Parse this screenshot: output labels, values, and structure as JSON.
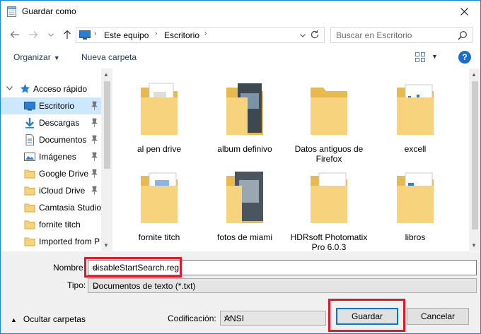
{
  "window": {
    "title": "Guardar como"
  },
  "address": {
    "crumbs": [
      "Este equipo",
      "Escritorio"
    ]
  },
  "search": {
    "placeholder": "Buscar en Escritorio"
  },
  "toolbar": {
    "organize_label": "Organizar",
    "new_folder_label": "Nueva carpeta"
  },
  "nav": {
    "quick_access": "Acceso rápido",
    "items": [
      {
        "label": "Escritorio",
        "icon": "desktop-icon",
        "pinned": true,
        "selected": true
      },
      {
        "label": "Descargas",
        "icon": "download-icon",
        "pinned": true
      },
      {
        "label": "Documentos",
        "icon": "documents-icon",
        "pinned": true
      },
      {
        "label": "Imágenes",
        "icon": "pictures-icon",
        "pinned": true
      },
      {
        "label": "Google Drive",
        "icon": "folder-icon",
        "pinned": true
      },
      {
        "label": "iCloud Drive",
        "icon": "folder-icon",
        "pinned": true
      },
      {
        "label": "Camtasia Studio",
        "icon": "folder-icon",
        "pinned": false
      },
      {
        "label": "fornite titch",
        "icon": "folder-icon",
        "pinned": false
      },
      {
        "label": "Imported from P",
        "icon": "folder-icon",
        "pinned": false
      }
    ]
  },
  "files": [
    {
      "label": "al pen drive"
    },
    {
      "label": "album definivo"
    },
    {
      "label": "Datos antiguos de Firefox"
    },
    {
      "label": "excell"
    },
    {
      "label": "fornite titch"
    },
    {
      "label": "fotos de miami"
    },
    {
      "label": "HDRsoft Photomatix Pro 6.0.3"
    },
    {
      "label": "libros"
    }
  ],
  "form": {
    "name_label": "Nombre:",
    "name_value": "disableStartSearch.reg",
    "type_label": "Tipo:",
    "type_value": "Documentos de texto (*.txt)",
    "hide_folders_label": "Ocultar carpetas",
    "encoding_label": "Codificación:",
    "encoding_value": "ANSI",
    "save_label": "Guardar",
    "cancel_label": "Cancelar"
  },
  "colors": {
    "accent": "#0078d7",
    "selection": "#cce8ff",
    "highlight": "#e0182a",
    "folder": "#f7d37e"
  }
}
